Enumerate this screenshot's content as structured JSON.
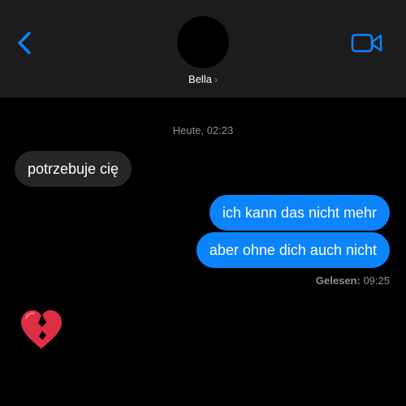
{
  "header": {
    "contact_name": "Bella",
    "chevron": "›",
    "back_icon": "chevron-left-icon",
    "call_icon": "video-camera-icon"
  },
  "conversation": {
    "timestamp_label": "Heute,",
    "timestamp_time": "02:23",
    "messages": [
      {
        "direction": "incoming",
        "text": "potrzebuje cię"
      },
      {
        "direction": "outgoing",
        "text": "ich kann das nicht mehr"
      },
      {
        "direction": "outgoing",
        "text": "aber ohne dich auch nicht"
      },
      {
        "direction": "incoming",
        "emoji": "💔",
        "icon": "broken-heart-icon"
      }
    ],
    "read_receipt_label": "Gelesen:",
    "read_receipt_time": "09:25"
  },
  "colors": {
    "accent": "#0b84fe",
    "header_bg": "#1c1c1e",
    "incoming_bubble": "#262628",
    "secondary_text": "#8e8e93"
  }
}
